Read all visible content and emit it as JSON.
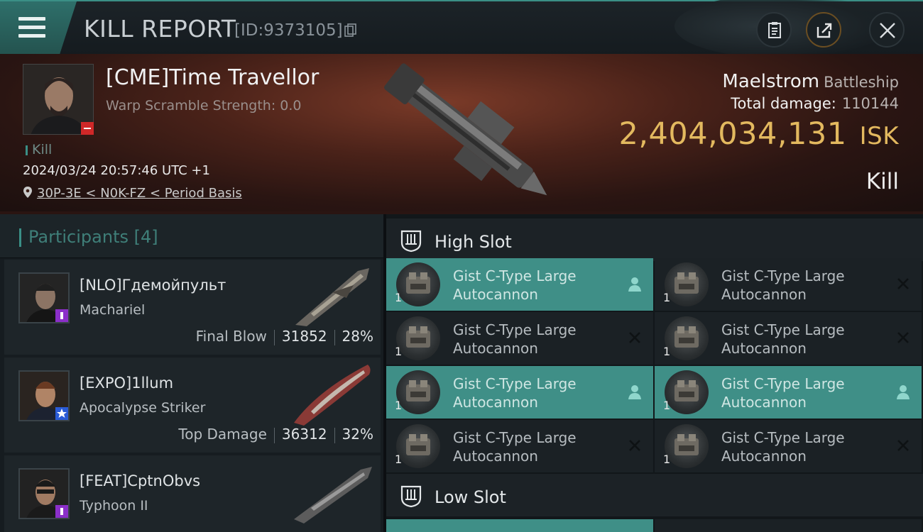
{
  "header": {
    "title": "KILL REPORT",
    "kill_id": "[ID:9373105]"
  },
  "victim": {
    "name": "[CME]Time Travellor",
    "scramble": "Warp Scramble Strength: 0.0",
    "tag": "Kill",
    "datetime": "2024/03/24 20:57:46 UTC +1",
    "location": "30P-3E < N0K-FZ < Period Basis"
  },
  "ship": {
    "name": "Maelstrom",
    "class": "Battleship",
    "total_damage_label": "Total damage:",
    "total_damage": "110144",
    "isk_value": "2,404,034,131",
    "isk_unit": "ISK",
    "result": "Kill"
  },
  "participants": {
    "label": "Participants",
    "count": "[4]",
    "items": [
      {
        "name": "[NLO]Гдемойпульт",
        "ship": "Machariel",
        "role": "Final Blow",
        "damage": "31852",
        "percent": "28%"
      },
      {
        "name": "[EXPO]1llum",
        "ship": "Apocalypse Striker",
        "role": "Top Damage",
        "damage": "36312",
        "percent": "32%"
      },
      {
        "name": "[FEAT]CptnObvs",
        "ship": "Typhoon II",
        "role": "",
        "damage": "",
        "percent": ""
      }
    ]
  },
  "fitting": {
    "high_slot_label": "High Slot",
    "low_slot_label": "Low Slot",
    "high_modules": [
      {
        "line1": "Gist C-Type Large",
        "line2": "Autocannon",
        "qty": "1",
        "status": "dropped"
      },
      {
        "line1": "Gist C-Type Large",
        "line2": "Autocannon",
        "qty": "1",
        "status": "destroyed"
      },
      {
        "line1": "Gist C-Type Large",
        "line2": "Autocannon",
        "qty": "1",
        "status": "destroyed"
      },
      {
        "line1": "Gist C-Type Large",
        "line2": "Autocannon",
        "qty": "1",
        "status": "destroyed"
      },
      {
        "line1": "Gist C-Type Large",
        "line2": "Autocannon",
        "qty": "1",
        "status": "dropped"
      },
      {
        "line1": "Gist C-Type Large",
        "line2": "Autocannon",
        "qty": "1",
        "status": "dropped"
      },
      {
        "line1": "Gist C-Type Large",
        "line2": "Autocannon",
        "qty": "1",
        "status": "destroyed"
      },
      {
        "line1": "Gist C-Type Large",
        "line2": "Autocannon",
        "qty": "1",
        "status": "destroyed"
      }
    ]
  },
  "colors": {
    "accent": "#3f8f87",
    "isk": "#e3b95f",
    "header_bg": "#151b1f"
  },
  "icons": [
    "menu-icon",
    "copy-icon",
    "clipboard-icon",
    "share-icon",
    "close-icon",
    "location-pin-icon",
    "slot-icon",
    "person-icon",
    "cross-icon"
  ]
}
